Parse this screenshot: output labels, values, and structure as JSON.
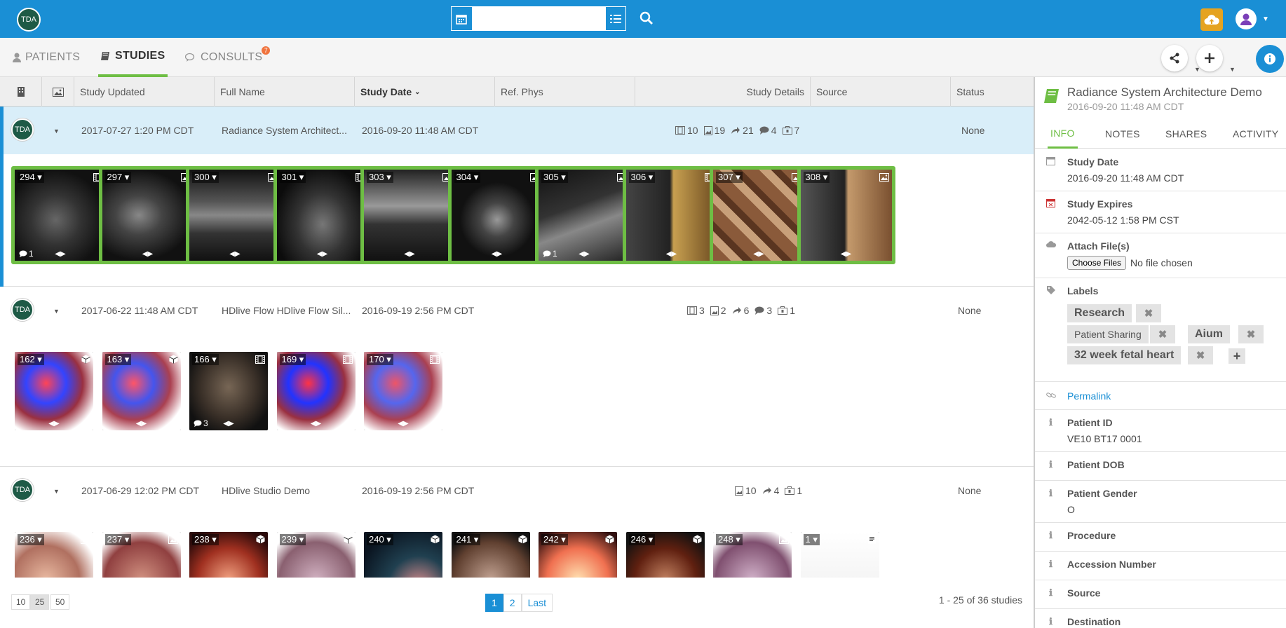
{
  "header": {
    "logo_text": "TDA",
    "search_placeholder": ""
  },
  "nav": {
    "tabs": [
      {
        "label": "PATIENTS"
      },
      {
        "label": "STUDIES"
      },
      {
        "label": "CONSULTS"
      }
    ],
    "consults_badge": "7"
  },
  "table": {
    "columns": [
      "Study Updated",
      "Full Name",
      "Study Date",
      "Ref. Phys",
      "Study Details",
      "Source",
      "Status"
    ],
    "sorted_column": "Study Date"
  },
  "studies": [
    {
      "avatar": "TDA",
      "updated": "2017-07-27 1:20 PM CDT",
      "name": "Radiance System Architect...",
      "date": "2016-09-20 11:48 AM CDT",
      "ref_phys": "",
      "source": "",
      "status": "None",
      "details": {
        "films": "10",
        "images": "19",
        "shares": "21",
        "comments": "4",
        "reports": "7"
      },
      "thumbs": [
        {
          "num": "294",
          "icon": "film-icon",
          "comments": "1"
        },
        {
          "num": "297",
          "icon": "image-icon",
          "comments": ""
        },
        {
          "num": "300",
          "icon": "image-icon",
          "comments": ""
        },
        {
          "num": "301",
          "icon": "film-icon",
          "comments": ""
        },
        {
          "num": "303",
          "icon": "image-icon",
          "comments": ""
        },
        {
          "num": "304",
          "icon": "image-icon",
          "comments": ""
        },
        {
          "num": "305",
          "icon": "image-icon",
          "comments": "1"
        },
        {
          "num": "306",
          "icon": "film-icon",
          "comments": ""
        },
        {
          "num": "307",
          "icon": "image-icon",
          "comments": ""
        },
        {
          "num": "308",
          "icon": "image-icon",
          "comments": ""
        }
      ]
    },
    {
      "avatar": "TDA",
      "updated": "2017-06-22 11:48 AM CDT",
      "name": "HDlive Flow HDlive Flow Sil...",
      "date": "2016-09-19 2:56 PM CDT",
      "ref_phys": "",
      "source": "",
      "status": "None",
      "details": {
        "films": "3",
        "images": "2",
        "shares": "6",
        "comments": "3",
        "reports": "1"
      },
      "thumbs": [
        {
          "num": "162",
          "icon": "cube-icon",
          "comments": ""
        },
        {
          "num": "163",
          "icon": "cube-icon",
          "comments": ""
        },
        {
          "num": "166",
          "icon": "film-icon",
          "comments": "3"
        },
        {
          "num": "169",
          "icon": "film-icon",
          "comments": ""
        },
        {
          "num": "170",
          "icon": "film-icon",
          "comments": ""
        }
      ]
    },
    {
      "avatar": "TDA",
      "updated": "2017-06-29 12:02 PM CDT",
      "name": "HDlive Studio Demo",
      "date": "2016-09-19 2:56 PM CDT",
      "ref_phys": "",
      "source": "",
      "status": "None",
      "details": {
        "images": "10",
        "shares": "4",
        "reports": "1"
      },
      "thumbs": [
        {
          "num": "236",
          "icon": "image-icon"
        },
        {
          "num": "237",
          "icon": "image-icon"
        },
        {
          "num": "238",
          "icon": "cube-icon"
        },
        {
          "num": "239",
          "icon": "cube-icon"
        },
        {
          "num": "240",
          "icon": "cube-icon"
        },
        {
          "num": "241",
          "icon": "cube-icon"
        },
        {
          "num": "242",
          "icon": "cube-icon"
        },
        {
          "num": "246",
          "icon": "cube-icon"
        },
        {
          "num": "248",
          "icon": "image-icon"
        },
        {
          "num": "1",
          "icon": "report-icon"
        }
      ]
    }
  ],
  "footer": {
    "page_sizes": [
      "10",
      "25",
      "50"
    ],
    "active_size": "25",
    "pages": [
      "1",
      "2",
      "Last"
    ],
    "count_text": "1 - 25 of 36 studies"
  },
  "sidebar": {
    "title": "Radiance System Architecture Demo",
    "subtitle": "2016-09-20 11:48 AM CDT",
    "tabs": [
      "INFO",
      "NOTES",
      "SHARES",
      "ACTIVITY"
    ],
    "study_date_label": "Study Date",
    "study_date": "2016-09-20 11:48 AM CDT",
    "expires_label": "Study Expires",
    "expires": "2042-05-12 1:58 PM CST",
    "attach_label": "Attach File(s)",
    "choose_files": "Choose Files",
    "no_file": "No file chosen",
    "labels_label": "Labels",
    "labels": [
      "Research",
      "Patient Sharing",
      "Aium",
      "32 week fetal heart"
    ],
    "permalink": "Permalink",
    "patient_id_label": "Patient ID",
    "patient_id": "VE10 BT17 0001",
    "dob_label": "Patient DOB",
    "gender_label": "Patient Gender",
    "gender": "O",
    "procedure_label": "Procedure",
    "accession_label": "Accession Number",
    "source_label": "Source",
    "destination_label": "Destination"
  },
  "colors": {
    "primary": "#1a8fd5",
    "accent_green": "#6ebe44",
    "upload": "#e5a320",
    "badge": "#f0743e"
  }
}
